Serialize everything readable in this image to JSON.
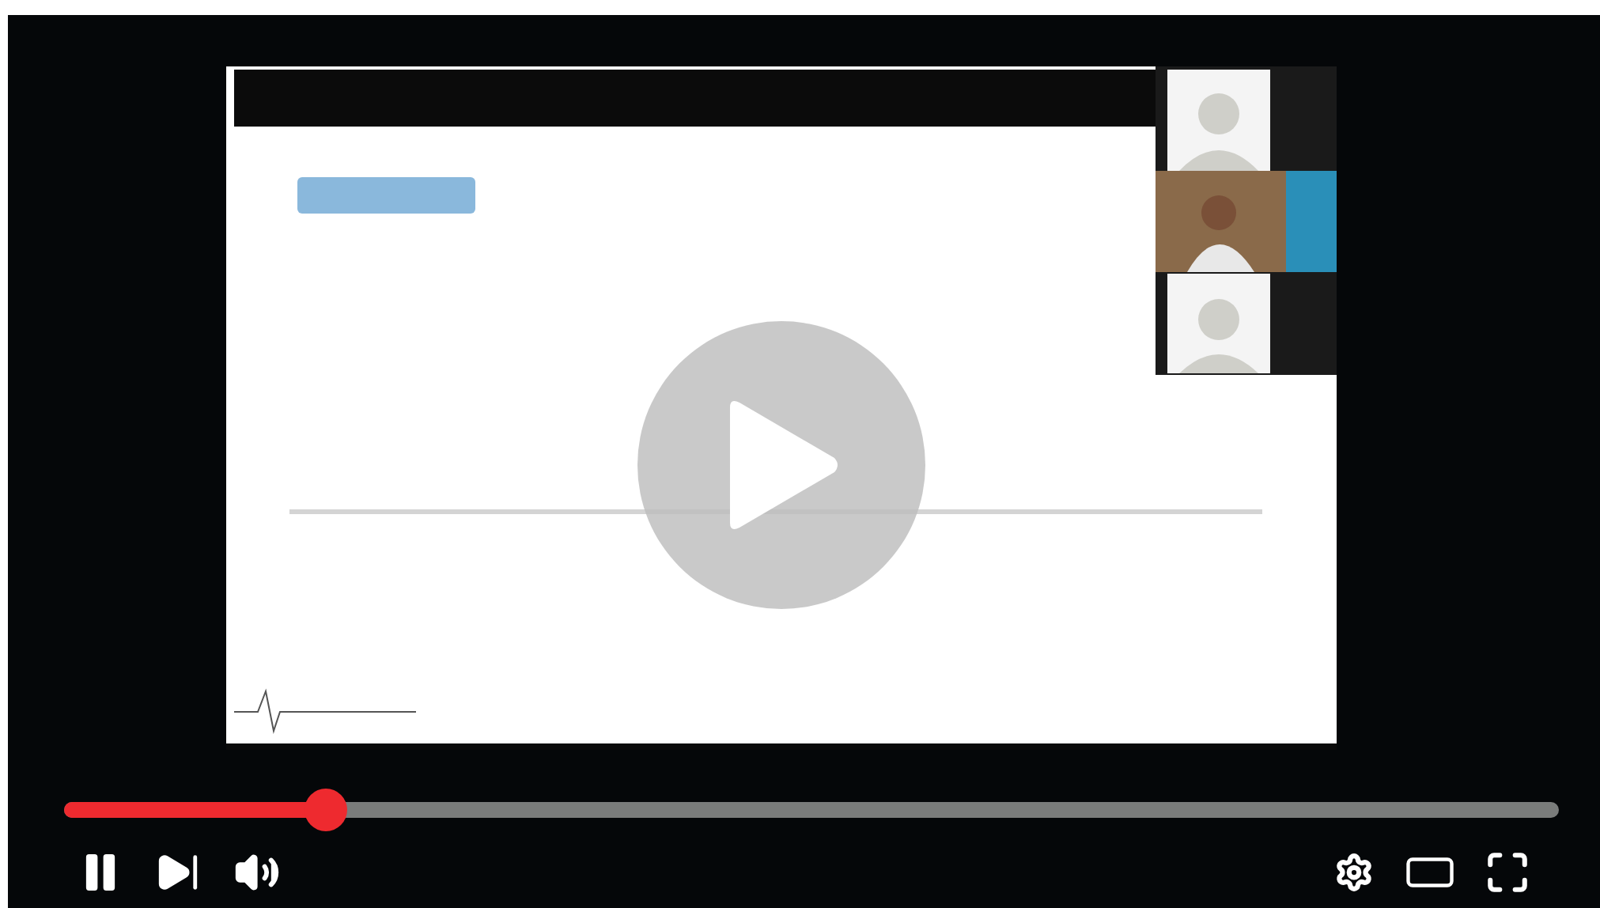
{
  "player": {
    "playing": true,
    "muted": false,
    "progress": {
      "level": 0.175
    }
  }
}
